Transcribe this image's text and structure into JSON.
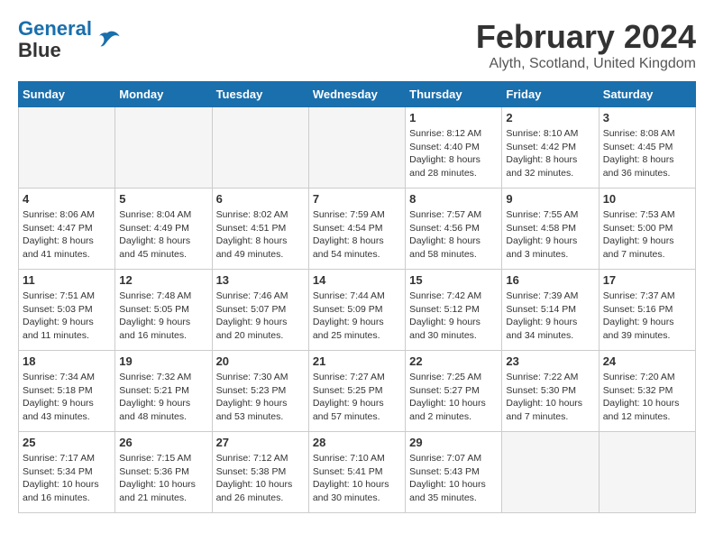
{
  "header": {
    "logo_line1": "General",
    "logo_line2": "Blue",
    "month_title": "February 2024",
    "location": "Alyth, Scotland, United Kingdom"
  },
  "days_of_week": [
    "Sunday",
    "Monday",
    "Tuesday",
    "Wednesday",
    "Thursday",
    "Friday",
    "Saturday"
  ],
  "weeks": [
    [
      {
        "day": "",
        "data": ""
      },
      {
        "day": "",
        "data": ""
      },
      {
        "day": "",
        "data": ""
      },
      {
        "day": "",
        "data": ""
      },
      {
        "day": "1",
        "data": "Sunrise: 8:12 AM\nSunset: 4:40 PM\nDaylight: 8 hours\nand 28 minutes."
      },
      {
        "day": "2",
        "data": "Sunrise: 8:10 AM\nSunset: 4:42 PM\nDaylight: 8 hours\nand 32 minutes."
      },
      {
        "day": "3",
        "data": "Sunrise: 8:08 AM\nSunset: 4:45 PM\nDaylight: 8 hours\nand 36 minutes."
      }
    ],
    [
      {
        "day": "4",
        "data": "Sunrise: 8:06 AM\nSunset: 4:47 PM\nDaylight: 8 hours\nand 41 minutes."
      },
      {
        "day": "5",
        "data": "Sunrise: 8:04 AM\nSunset: 4:49 PM\nDaylight: 8 hours\nand 45 minutes."
      },
      {
        "day": "6",
        "data": "Sunrise: 8:02 AM\nSunset: 4:51 PM\nDaylight: 8 hours\nand 49 minutes."
      },
      {
        "day": "7",
        "data": "Sunrise: 7:59 AM\nSunset: 4:54 PM\nDaylight: 8 hours\nand 54 minutes."
      },
      {
        "day": "8",
        "data": "Sunrise: 7:57 AM\nSunset: 4:56 PM\nDaylight: 8 hours\nand 58 minutes."
      },
      {
        "day": "9",
        "data": "Sunrise: 7:55 AM\nSunset: 4:58 PM\nDaylight: 9 hours\nand 3 minutes."
      },
      {
        "day": "10",
        "data": "Sunrise: 7:53 AM\nSunset: 5:00 PM\nDaylight: 9 hours\nand 7 minutes."
      }
    ],
    [
      {
        "day": "11",
        "data": "Sunrise: 7:51 AM\nSunset: 5:03 PM\nDaylight: 9 hours\nand 11 minutes."
      },
      {
        "day": "12",
        "data": "Sunrise: 7:48 AM\nSunset: 5:05 PM\nDaylight: 9 hours\nand 16 minutes."
      },
      {
        "day": "13",
        "data": "Sunrise: 7:46 AM\nSunset: 5:07 PM\nDaylight: 9 hours\nand 20 minutes."
      },
      {
        "day": "14",
        "data": "Sunrise: 7:44 AM\nSunset: 5:09 PM\nDaylight: 9 hours\nand 25 minutes."
      },
      {
        "day": "15",
        "data": "Sunrise: 7:42 AM\nSunset: 5:12 PM\nDaylight: 9 hours\nand 30 minutes."
      },
      {
        "day": "16",
        "data": "Sunrise: 7:39 AM\nSunset: 5:14 PM\nDaylight: 9 hours\nand 34 minutes."
      },
      {
        "day": "17",
        "data": "Sunrise: 7:37 AM\nSunset: 5:16 PM\nDaylight: 9 hours\nand 39 minutes."
      }
    ],
    [
      {
        "day": "18",
        "data": "Sunrise: 7:34 AM\nSunset: 5:18 PM\nDaylight: 9 hours\nand 43 minutes."
      },
      {
        "day": "19",
        "data": "Sunrise: 7:32 AM\nSunset: 5:21 PM\nDaylight: 9 hours\nand 48 minutes."
      },
      {
        "day": "20",
        "data": "Sunrise: 7:30 AM\nSunset: 5:23 PM\nDaylight: 9 hours\nand 53 minutes."
      },
      {
        "day": "21",
        "data": "Sunrise: 7:27 AM\nSunset: 5:25 PM\nDaylight: 9 hours\nand 57 minutes."
      },
      {
        "day": "22",
        "data": "Sunrise: 7:25 AM\nSunset: 5:27 PM\nDaylight: 10 hours\nand 2 minutes."
      },
      {
        "day": "23",
        "data": "Sunrise: 7:22 AM\nSunset: 5:30 PM\nDaylight: 10 hours\nand 7 minutes."
      },
      {
        "day": "24",
        "data": "Sunrise: 7:20 AM\nSunset: 5:32 PM\nDaylight: 10 hours\nand 12 minutes."
      }
    ],
    [
      {
        "day": "25",
        "data": "Sunrise: 7:17 AM\nSunset: 5:34 PM\nDaylight: 10 hours\nand 16 minutes."
      },
      {
        "day": "26",
        "data": "Sunrise: 7:15 AM\nSunset: 5:36 PM\nDaylight: 10 hours\nand 21 minutes."
      },
      {
        "day": "27",
        "data": "Sunrise: 7:12 AM\nSunset: 5:38 PM\nDaylight: 10 hours\nand 26 minutes."
      },
      {
        "day": "28",
        "data": "Sunrise: 7:10 AM\nSunset: 5:41 PM\nDaylight: 10 hours\nand 30 minutes."
      },
      {
        "day": "29",
        "data": "Sunrise: 7:07 AM\nSunset: 5:43 PM\nDaylight: 10 hours\nand 35 minutes."
      },
      {
        "day": "",
        "data": ""
      },
      {
        "day": "",
        "data": ""
      }
    ]
  ]
}
